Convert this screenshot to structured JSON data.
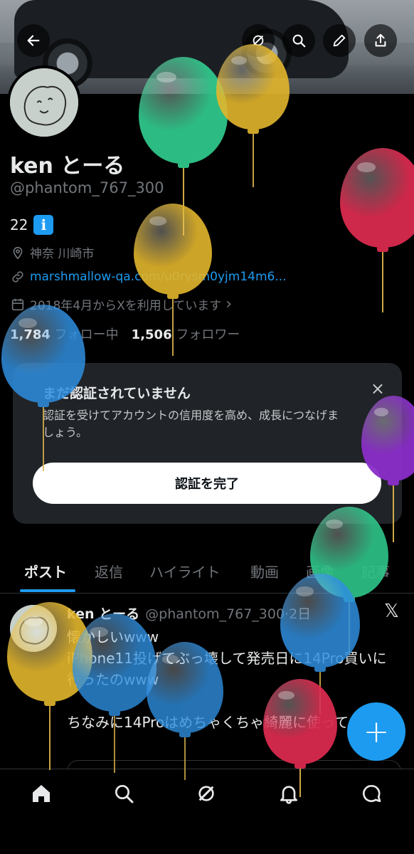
{
  "header": {
    "back_icon": "arrow-left-icon",
    "actions": [
      "grok-icon",
      "search-icon",
      "edit-icon",
      "share-icon"
    ]
  },
  "profile": {
    "name": "ken とーる",
    "handle": "@phantom_767_300",
    "bio": "22",
    "bio_emoji": "ℹ",
    "location": "神奈 川崎市",
    "website": "marshmallow-qa.com/u0rysm0yjm14m6...",
    "joined": "2018年4月からXを利用しています",
    "following_count": "1,784",
    "following_label": "フォロー中",
    "followers_count": "1,506",
    "followers_label": "フォロワー"
  },
  "verify_card": {
    "title": "まだ認証されていません",
    "description": "認証を受けてアカウントの信用度を高め、成長につなげましょう。",
    "button": "認証を完了",
    "close": "×"
  },
  "tabs": [
    "ポスト",
    "返信",
    "ハイライト",
    "動画",
    "画像",
    "記事"
  ],
  "post": {
    "author": "ken とーる",
    "handle_time": "@phantom_767_300·2日",
    "text": "懐かしいwww\niPhone11投げてぶっ壊して発売日に14Pro買いに行ったのwww\n\nちなみに14Proはめちゃくちゃ綺麗に使ってたw",
    "x_logo": "𝕏"
  },
  "fab_label": "+",
  "bottom_nav": [
    "home-icon",
    "search-icon",
    "grok-icon",
    "notifications-icon",
    "messages-icon"
  ],
  "colors": {
    "accent": "#1d9bf0",
    "balloon_green": "#2fc68a",
    "balloon_yellow": "#e3b62c",
    "balloon_red": "#d92a4e",
    "balloon_blue": "#2f8fe0",
    "balloon_purple": "#8a2ec9"
  }
}
